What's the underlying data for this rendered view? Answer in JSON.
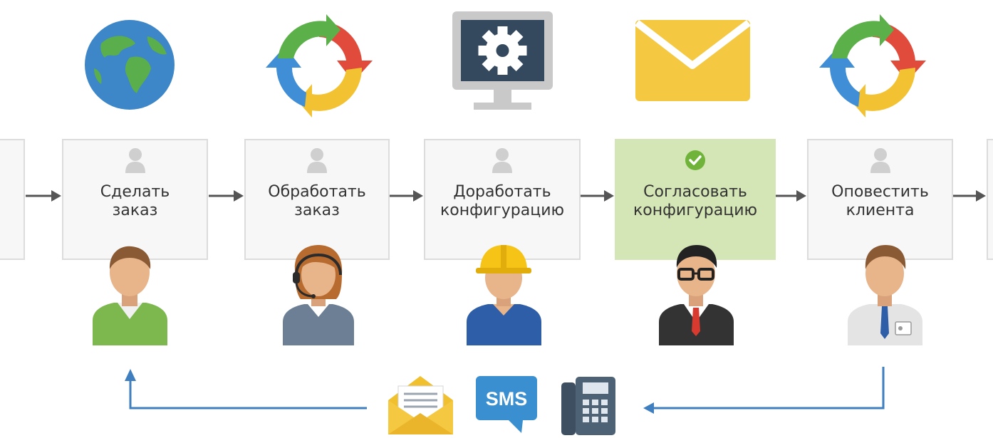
{
  "steps": [
    {
      "line1": "Сделать",
      "line2": "заказ"
    },
    {
      "line1": "Обработать",
      "line2": "заказ"
    },
    {
      "line1": "Доработать",
      "line2": "конфигурацию"
    },
    {
      "line1": "Согласовать",
      "line2": "конфигурацию"
    },
    {
      "line1": "Оповестить",
      "line2": "клиента"
    }
  ],
  "channels": {
    "sms_label": "SMS"
  },
  "icons": {
    "top": [
      "globe-icon",
      "cycle-arrows-icon",
      "monitor-gear-icon",
      "envelope-icon",
      "cycle-arrows-icon"
    ],
    "bottom": [
      "open-envelope-letter-icon",
      "sms-bubble-icon",
      "desk-phone-icon"
    ],
    "step_user": "user-icon",
    "approved_check": "check-circle-icon"
  },
  "colors": {
    "approved_fill": "#d4e6b5",
    "check_green": "#6fb33a",
    "feedback_arrow": "#3f7fc0",
    "flow_arrow": "#555555"
  }
}
